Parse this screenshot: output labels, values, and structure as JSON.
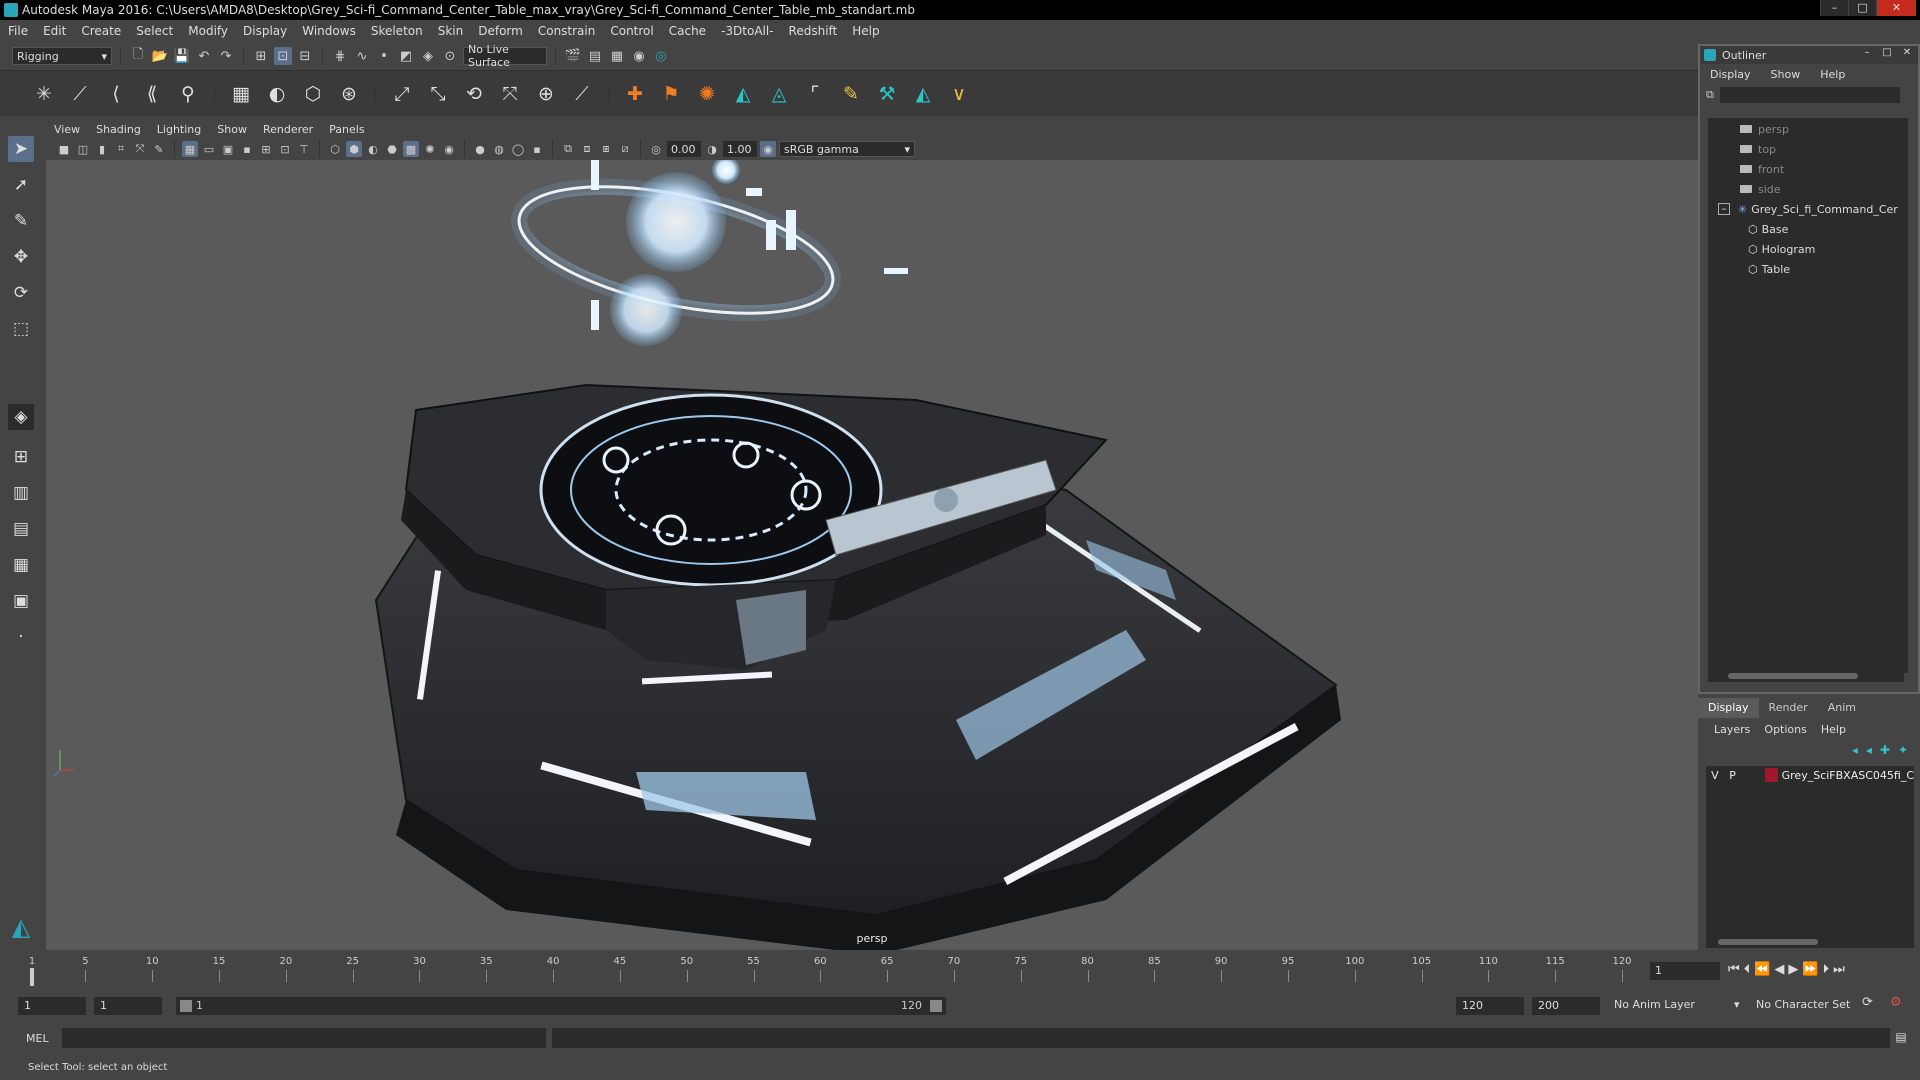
{
  "window": {
    "title": "Autodesk Maya 2016: C:\\Users\\AMDA8\\Desktop\\Grey_Sci-fi_Command_Center_Table_max_vray\\Grey_Sci-fi_Command_Center_Table_mb_standart.mb",
    "minimize": "–",
    "maximize": "□",
    "close": "✕"
  },
  "menubar": [
    "File",
    "Edit",
    "Create",
    "Select",
    "Modify",
    "Display",
    "Windows",
    "Skeleton",
    "Skin",
    "Deform",
    "Constrain",
    "Control",
    "Cache",
    "-3DtoAll-",
    "Redshift",
    "Help"
  ],
  "statusline": {
    "menu_set": "Rigging",
    "live_surface": "No Live Surface"
  },
  "viewport": {
    "menu": [
      "View",
      "Shading",
      "Lighting",
      "Show",
      "Renderer",
      "Panels"
    ],
    "exposure": "0.00",
    "gamma": "1.00",
    "color_space": "sRGB gamma",
    "camera": "persp"
  },
  "outliner": {
    "title": "Outliner",
    "menu": [
      "Display",
      "Show",
      "Help"
    ],
    "items": [
      {
        "label": "persp",
        "kind": "camera"
      },
      {
        "label": "top",
        "kind": "camera"
      },
      {
        "label": "front",
        "kind": "camera"
      },
      {
        "label": "side",
        "kind": "camera"
      },
      {
        "label": "Grey_Sci_fi_Command_Cer",
        "kind": "group"
      },
      {
        "label": "Base",
        "kind": "mesh"
      },
      {
        "label": "Hologram",
        "kind": "mesh"
      },
      {
        "label": "Table",
        "kind": "mesh"
      }
    ]
  },
  "layers": {
    "tabs": [
      "Display",
      "Render",
      "Anim"
    ],
    "active_tab": "Display",
    "menu": [
      "Layers",
      "Options",
      "Help"
    ],
    "layer": {
      "visible": "V",
      "playback": "P",
      "name": "Grey_SciFBXASC045fi_C",
      "color": "#a4152e"
    }
  },
  "timeline": {
    "ticks": [
      1,
      5,
      10,
      15,
      20,
      25,
      30,
      35,
      40,
      45,
      50,
      55,
      60,
      65,
      70,
      75,
      80,
      85,
      90,
      95,
      100,
      105,
      110,
      115,
      120
    ],
    "current_frame": "1"
  },
  "range": {
    "start": "1",
    "playback_start": "1",
    "slider_start": "1",
    "slider_end": "120",
    "playback_end": "120",
    "end": "200",
    "anim_layer": "No Anim Layer",
    "character_set": "No Character Set"
  },
  "command": {
    "label": "MEL"
  },
  "helpline": "Select Tool: select an object",
  "colors": {
    "accent": "#5b6f8a",
    "maya_teal": "#2aa6b8",
    "layer_red": "#a4152e"
  }
}
